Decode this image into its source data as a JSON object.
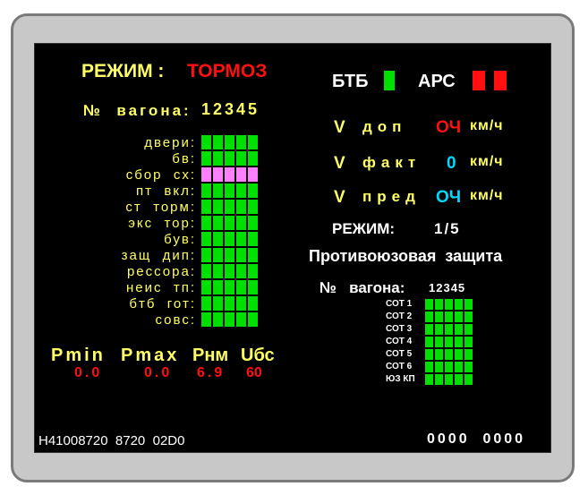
{
  "colors": {
    "on": "#00e000",
    "fault": "#ff80ff",
    "alarm": "#ff1010",
    "label": "#ffff66",
    "cyan": "#00d8ff"
  },
  "left": {
    "mode_label": "РЕЖИМ :",
    "mode_value": "ТОРМОЗ",
    "car_no_label": "№  вагона:",
    "car_numbers": "12345",
    "rows": [
      {
        "label": "двери:",
        "states": [
          "on",
          "on",
          "on",
          "on",
          "on"
        ]
      },
      {
        "label": "бв:",
        "states": [
          "on",
          "on",
          "on",
          "on",
          "on"
        ]
      },
      {
        "label": "сбор  сх:",
        "states": [
          "fault",
          "fault",
          "fault",
          "fault",
          "fault"
        ]
      },
      {
        "label": "пт  вкл:",
        "states": [
          "on",
          "on",
          "on",
          "on",
          "on"
        ]
      },
      {
        "label": "ст  торм:",
        "states": [
          "on",
          "on",
          "on",
          "on",
          "on"
        ]
      },
      {
        "label": "экс  тор:",
        "states": [
          "on",
          "on",
          "on",
          "on",
          "on"
        ]
      },
      {
        "label": "був:",
        "states": [
          "on",
          "on",
          "on",
          "on",
          "on"
        ]
      },
      {
        "label": "защ  дип:",
        "states": [
          "on",
          "on",
          "on",
          "on",
          "on"
        ]
      },
      {
        "label": "рессора:",
        "states": [
          "on",
          "on",
          "on",
          "on",
          "on"
        ]
      },
      {
        "label": "неис  тп:",
        "states": [
          "on",
          "on",
          "on",
          "on",
          "on"
        ]
      },
      {
        "label": "бтб  гот:",
        "states": [
          "on",
          "on",
          "on",
          "on",
          "on"
        ]
      },
      {
        "label": "совс:",
        "states": [
          "on",
          "on",
          "on",
          "on",
          "on"
        ]
      }
    ],
    "pressure_headers": [
      "Pmin",
      "Pmax",
      "Pнм",
      "Uбс"
    ],
    "pressure_values": [
      "0.0",
      "0.0",
      "6.9",
      "60"
    ]
  },
  "right": {
    "btb_label": "БТБ",
    "ars_label": "АРС",
    "btb_indicator": "on",
    "ars_indicators": [
      "alarm",
      "alarm"
    ],
    "v_rows": [
      {
        "v": "V",
        "label": "доп",
        "value": "ОЧ",
        "value_color": "alarm",
        "unit": "км/ч"
      },
      {
        "v": "V",
        "label": "факт",
        "value": "0",
        "value_color": "cyan",
        "unit": "км/ч"
      },
      {
        "v": "V",
        "label": "пред",
        "value": "ОЧ",
        "value_color": "cyan",
        "unit": "км/ч"
      }
    ],
    "mode_label": "РЕЖИМ:",
    "mode_value": "1/5",
    "antislip_title": "Противоюзовая  защита",
    "car_no_label": "№   вагона:",
    "car_numbers": "12345",
    "rows": [
      {
        "label": "СОТ 1",
        "states": [
          "on",
          "on",
          "on",
          "on",
          "on"
        ]
      },
      {
        "label": "СОТ 2",
        "states": [
          "on",
          "on",
          "on",
          "on",
          "on"
        ]
      },
      {
        "label": "СОТ 3",
        "states": [
          "on",
          "on",
          "on",
          "on",
          "on"
        ]
      },
      {
        "label": "СОТ 4",
        "states": [
          "on",
          "on",
          "on",
          "on",
          "on"
        ]
      },
      {
        "label": "СОТ 5",
        "states": [
          "on",
          "on",
          "on",
          "on",
          "on"
        ]
      },
      {
        "label": "СОТ 6",
        "states": [
          "on",
          "on",
          "on",
          "on",
          "on"
        ]
      },
      {
        "label": "ЮЗ КП",
        "states": [
          "on",
          "on",
          "on",
          "on",
          "on"
        ]
      }
    ]
  },
  "footer": {
    "left_text": "H41008720  8720  02D0",
    "right_text": "0000  0000"
  }
}
